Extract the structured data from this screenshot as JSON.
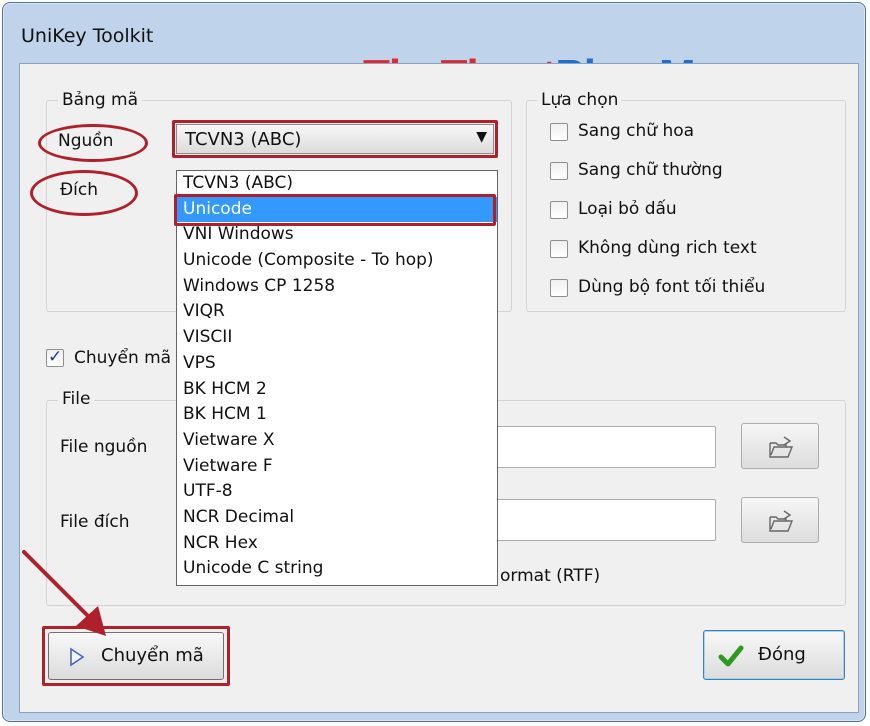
{
  "window": {
    "title": "UniKey Toolkit"
  },
  "watermark": {
    "part1": "ThuThuat",
    "part2": "PhanMem.vn"
  },
  "bang_ma": {
    "group_label": "Bảng mã",
    "source_label": "Nguồn",
    "target_label": "Đích",
    "source_value": "TCVN3 (ABC)",
    "target_options": [
      "TCVN3 (ABC)",
      "Unicode",
      "VNI Windows",
      "Unicode (Composite - To hop)",
      "Windows CP 1258",
      "VIQR",
      "VISCII",
      "VPS",
      "BK HCM 2",
      "BK HCM 1",
      "Vietware X",
      "Vietware F",
      "UTF-8",
      "NCR Decimal",
      "NCR Hex",
      "Unicode C string"
    ],
    "selected_target": "Unicode"
  },
  "lua_chon": {
    "group_label": "Lựa chọn",
    "options": [
      {
        "label": "Sang chữ hoa",
        "checked": false
      },
      {
        "label": "Sang chữ thường",
        "checked": false
      },
      {
        "label": "Loại bỏ dấu",
        "checked": false
      },
      {
        "label": "Không dùng rich text",
        "checked": false
      },
      {
        "label": "Dùng bộ font tối thiểu",
        "checked": false
      }
    ]
  },
  "clipboard_option": {
    "label": "Chuyển mã",
    "checked": true
  },
  "file": {
    "group_label": "File",
    "source_label": "File nguồn",
    "target_label": "File đích",
    "rtf_label_visible": "ormat (RTF)"
  },
  "buttons": {
    "convert": "Chuyển mã",
    "close": "Đóng"
  },
  "colors": {
    "highlight": "#3399ff",
    "annotation": "#b0202a",
    "watermark_red": "#e0282f",
    "watermark_blue": "#1f6fd0"
  }
}
